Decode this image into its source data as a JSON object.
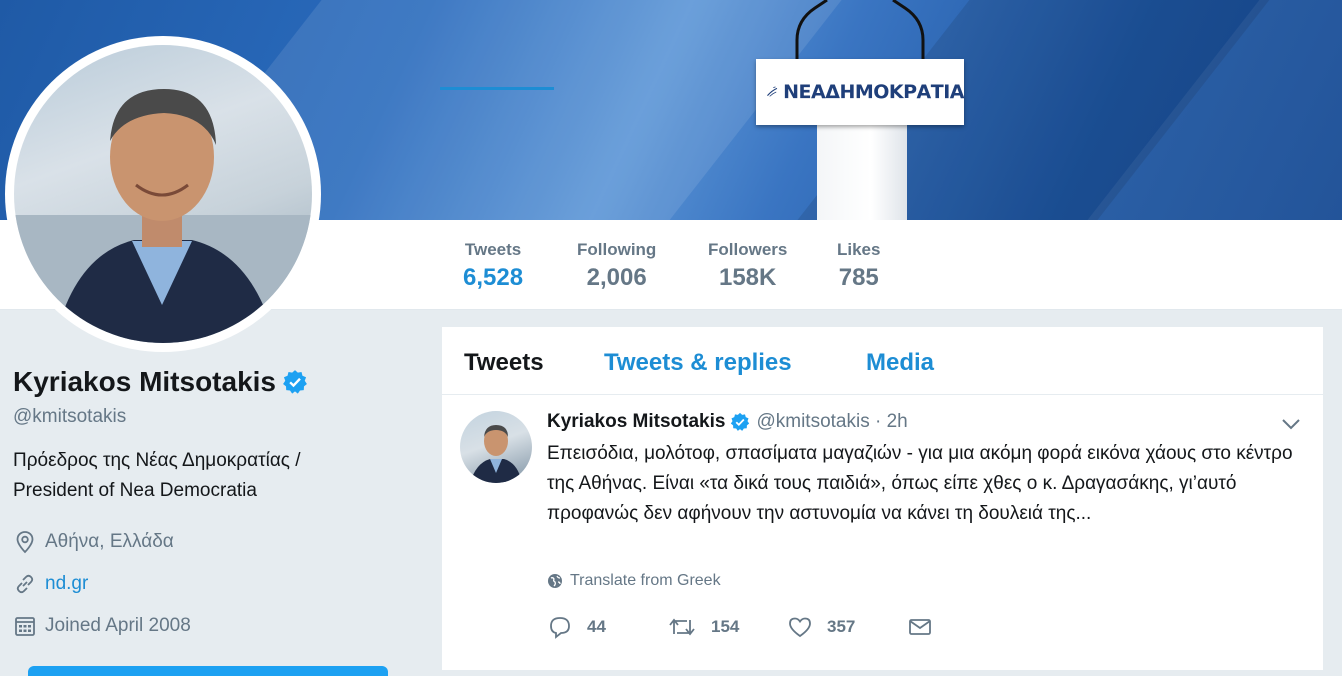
{
  "banner": {
    "sign_text": "ΝΕΑΔΗΜΟΚΡΑΤΙΑ"
  },
  "nav": {
    "stats": [
      {
        "label": "Tweets",
        "value": "6,528"
      },
      {
        "label": "Following",
        "value": "2,006"
      },
      {
        "label": "Followers",
        "value": "158K"
      },
      {
        "label": "Likes",
        "value": "785"
      }
    ]
  },
  "profile": {
    "name": "Kyriakos Mitsotakis",
    "handle": "@kmitsotakis",
    "bio_line1": "Πρόεδρος της Νέας Δημοκρατίας /",
    "bio_line2": "President of Nea Democratia",
    "location": "Αθήνα, Ελλάδα",
    "website": "nd.gr",
    "joined": "Joined April 2008"
  },
  "tabs": [
    {
      "label": "Tweets"
    },
    {
      "label": "Tweets & replies"
    },
    {
      "label": "Media"
    }
  ],
  "tweet": {
    "name": "Kyriakos Mitsotakis",
    "handle_time": "@kmitsotakis · 2h",
    "text": "Επεισόδια, μολότοφ, σπασίματα μαγαζιών - για μια ακόμη φορά εικόνα χάους στο κέντρο της Αθήνας. Είναι «τα δικά τους παιδιά», όπως είπε χθες ο κ. Δραγασάκης, γι’αυτό προφανώς δεν αφήνουν την αστυνομία να κάνει τη δουλειά της...",
    "translate": "Translate from Greek",
    "replies": "44",
    "retweets": "154",
    "likes": "357"
  },
  "colors": {
    "accent": "#1d8dd4",
    "muted": "#657786",
    "banner": "#1f5aa6"
  }
}
